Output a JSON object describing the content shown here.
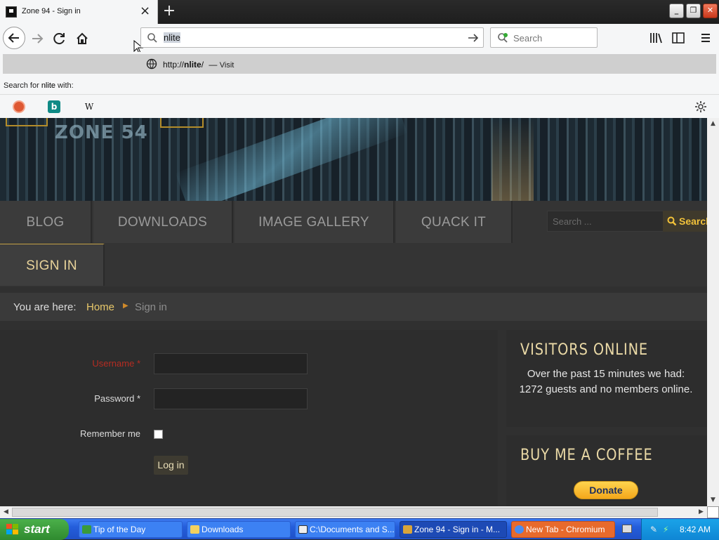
{
  "browser": {
    "tab_title": "Zone 94 - Sign in",
    "tab_close": "×",
    "new_tab": "+",
    "url_value": "nlite",
    "search_placeholder": "Search",
    "suggestion": {
      "prefix": "http://",
      "bold": "nlite",
      "suffix": "/",
      "dash": "—",
      "visit": "Visit"
    },
    "search_for_prefix": "Search for ",
    "search_for_term": "nlite",
    "search_for_suffix": " with:",
    "engines": [
      "duckduckgo-icon",
      "bing-icon",
      "wikipedia-icon"
    ],
    "wikipedia_glyph": "W",
    "bing_glyph": "b"
  },
  "site": {
    "logo": "ZONE 54",
    "menu": [
      "BLOG",
      "DOWNLOADS",
      "IMAGE GALLERY",
      "QUACK IT",
      "SIGN IN"
    ],
    "menu_search_placeholder": "Search ...",
    "menu_search_button": "Search",
    "breadcrumb": {
      "label": "You are here:",
      "home": "Home",
      "sep": "▶",
      "current": "Sign in"
    },
    "form": {
      "username_label": "Username *",
      "password_label": "Password *",
      "remember_label": "Remember me",
      "login_button": "Log in"
    },
    "visitors": {
      "title": "VISITORS ONLINE",
      "body": "Over the past 15 minutes we had: 1272 guests and no members online."
    },
    "coffee": {
      "title": "BUY ME A COFFEE",
      "donate": "Donate"
    }
  },
  "taskbar": {
    "start": "start",
    "tasks": [
      "Tip of the Day",
      "Downloads",
      "C:\\Documents and S...",
      "Zone 94 - Sign in - M...",
      "New Tab - Chromium"
    ],
    "clock": "8:42 AM"
  },
  "colors": {
    "accent_gold": "#e8c86a",
    "required_red": "#b52c22",
    "xp_blue": "#245ddb"
  }
}
